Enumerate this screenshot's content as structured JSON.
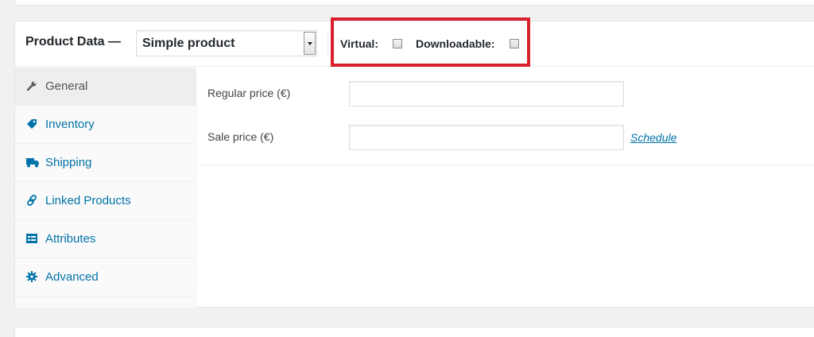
{
  "panel": {
    "title": "Product Data —",
    "product_type": {
      "selected": "Simple product"
    },
    "options": {
      "virtual_label": "Virtual:",
      "virtual_checked": false,
      "downloadable_label": "Downloadable:",
      "downloadable_checked": false
    },
    "highlight_color": "#d9202c"
  },
  "tabs": [
    {
      "label": "General",
      "icon": "wrench-icon",
      "active": true
    },
    {
      "label": "Inventory",
      "icon": "tag-icon",
      "active": false
    },
    {
      "label": "Shipping",
      "icon": "truck-icon",
      "active": false
    },
    {
      "label": "Linked Products",
      "icon": "link-icon",
      "active": false
    },
    {
      "label": "Attributes",
      "icon": "list-icon",
      "active": false
    },
    {
      "label": "Advanced",
      "icon": "gear-icon",
      "active": false
    }
  ],
  "general": {
    "regular_price_label": "Regular price (€)",
    "regular_price_value": "",
    "sale_price_label": "Sale price (€)",
    "sale_price_value": "",
    "schedule_link": "Schedule"
  },
  "colors": {
    "link": "#0073aa",
    "active_tab_bg": "#eeeeee"
  }
}
